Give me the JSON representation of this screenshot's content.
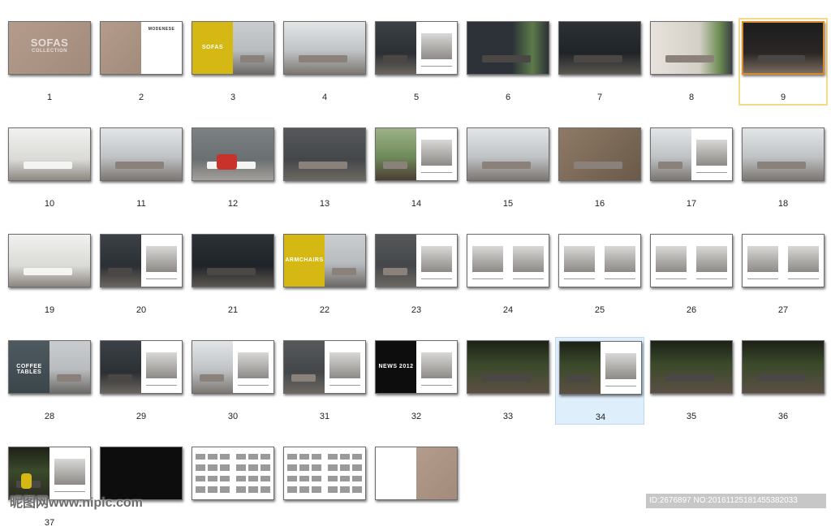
{
  "watermark": {
    "left": "昵图网www.nipic.com",
    "right": "ID:2676897 NO:20161125181455382033"
  },
  "colors": {
    "selected_outline": "#f3d98a",
    "hover_bg": "#dfeefb",
    "yellow": "#d6b814"
  },
  "pages": [
    {
      "n": "1",
      "kind": "cover",
      "style": "beige",
      "text": "SOFAS",
      "subtext": "COLLECTION"
    },
    {
      "n": "2",
      "kind": "split",
      "left": "beige",
      "right": "white",
      "subtext": "MODENESE"
    },
    {
      "n": "3",
      "kind": "split",
      "left": "yellow",
      "right": "room",
      "text": "SOFAS"
    },
    {
      "n": "4",
      "kind": "room",
      "style": "grey-window"
    },
    {
      "n": "5",
      "kind": "split",
      "left": "dark-room",
      "right": "white-photo"
    },
    {
      "n": "6",
      "kind": "room",
      "style": "dark-green"
    },
    {
      "n": "7",
      "kind": "room",
      "style": "dark"
    },
    {
      "n": "8",
      "kind": "room",
      "style": "shelf-green"
    },
    {
      "n": "9",
      "kind": "room",
      "style": "dark-orange",
      "state": "selected"
    },
    {
      "n": "10",
      "kind": "room",
      "style": "library-white"
    },
    {
      "n": "11",
      "kind": "room",
      "style": "grey-window"
    },
    {
      "n": "12",
      "kind": "room",
      "style": "grey-red"
    },
    {
      "n": "13",
      "kind": "room",
      "style": "library-dark"
    },
    {
      "n": "14",
      "kind": "split",
      "left": "garden",
      "right": "white-photo"
    },
    {
      "n": "15",
      "kind": "room",
      "style": "grey-window"
    },
    {
      "n": "16",
      "kind": "room",
      "style": "topdown"
    },
    {
      "n": "17",
      "kind": "split",
      "left": "grey-window",
      "right": "white-photo"
    },
    {
      "n": "18",
      "kind": "room",
      "style": "grey-window"
    },
    {
      "n": "19",
      "kind": "room",
      "style": "library-white"
    },
    {
      "n": "20",
      "kind": "split",
      "left": "dark-room",
      "right": "white-photo"
    },
    {
      "n": "21",
      "kind": "room",
      "style": "dark"
    },
    {
      "n": "22",
      "kind": "split",
      "left": "yellow",
      "right": "room",
      "text": "ARMCHAIRS"
    },
    {
      "n": "23",
      "kind": "split",
      "left": "library-dark",
      "right": "white-photo"
    },
    {
      "n": "24",
      "kind": "split",
      "left": "white-photo",
      "right": "white-photo"
    },
    {
      "n": "25",
      "kind": "split",
      "left": "white-photo",
      "right": "white-photo"
    },
    {
      "n": "26",
      "kind": "split",
      "left": "white-photo",
      "right": "white-photo"
    },
    {
      "n": "27",
      "kind": "split",
      "left": "white-photo",
      "right": "white-photo"
    },
    {
      "n": "28",
      "kind": "split",
      "left": "slate",
      "right": "room",
      "text": "COFFEE TABLES"
    },
    {
      "n": "29",
      "kind": "split",
      "left": "dark-room",
      "right": "white-photo"
    },
    {
      "n": "30",
      "kind": "split",
      "left": "grey-window",
      "right": "white-photo"
    },
    {
      "n": "31",
      "kind": "split",
      "left": "library-dark",
      "right": "white-photo"
    },
    {
      "n": "32",
      "kind": "split",
      "left": "black",
      "right": "white-photo",
      "text": "NEWS 2012"
    },
    {
      "n": "33",
      "kind": "room",
      "style": "jungle"
    },
    {
      "n": "34",
      "kind": "split",
      "left": "jungle",
      "right": "white-photo",
      "state": "hovered"
    },
    {
      "n": "35",
      "kind": "room",
      "style": "jungle"
    },
    {
      "n": "36",
      "kind": "room",
      "style": "jungle"
    },
    {
      "n": "37",
      "kind": "split",
      "left": "jungle-yellow",
      "right": "white-photo"
    },
    {
      "n": "",
      "kind": "split",
      "left": "black",
      "right": "black"
    },
    {
      "n": "",
      "kind": "split",
      "left": "catalog",
      "right": "catalog"
    },
    {
      "n": "",
      "kind": "split",
      "left": "catalog",
      "right": "catalog"
    },
    {
      "n": "",
      "kind": "split",
      "left": "white",
      "right": "beige"
    }
  ]
}
